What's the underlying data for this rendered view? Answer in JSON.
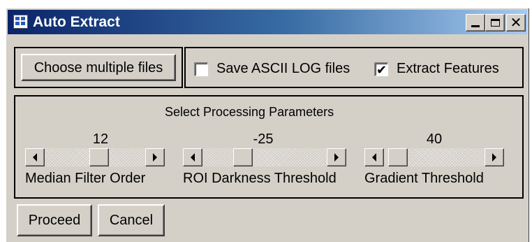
{
  "window": {
    "title": "Auto Extract",
    "title_icon": "app-window-icon",
    "controls": [
      {
        "name": "minimize",
        "icon": "minimize-icon"
      },
      {
        "name": "maximize",
        "icon": "maximize-icon"
      },
      {
        "name": "close",
        "icon": "close-icon",
        "glyph": "✕"
      }
    ]
  },
  "files": {
    "choose_button_label": "Choose multiple files"
  },
  "options": {
    "save_ascii_log": {
      "label": "Save ASCII LOG files",
      "checked": false
    },
    "extract_features": {
      "label": "Extract Features",
      "checked": true,
      "mark": "✔"
    }
  },
  "params": {
    "section_title": "Select Processing Parameters",
    "sliders": [
      {
        "label": "Median Filter Order",
        "value": "12",
        "position_fraction": 0.5
      },
      {
        "label": "ROI Darkness Threshold",
        "value": "-25",
        "position_fraction": 0.25
      },
      {
        "label": "Gradient Threshold",
        "value": "40",
        "position_fraction": 0.15
      }
    ]
  },
  "actions": {
    "proceed_label": "Proceed",
    "cancel_label": "Cancel"
  },
  "colors": {
    "face": "#d4d0c8",
    "titlebar_start": "#0a246a",
    "titlebar_end": "#a6caf0",
    "title_text": "#ffffff"
  }
}
